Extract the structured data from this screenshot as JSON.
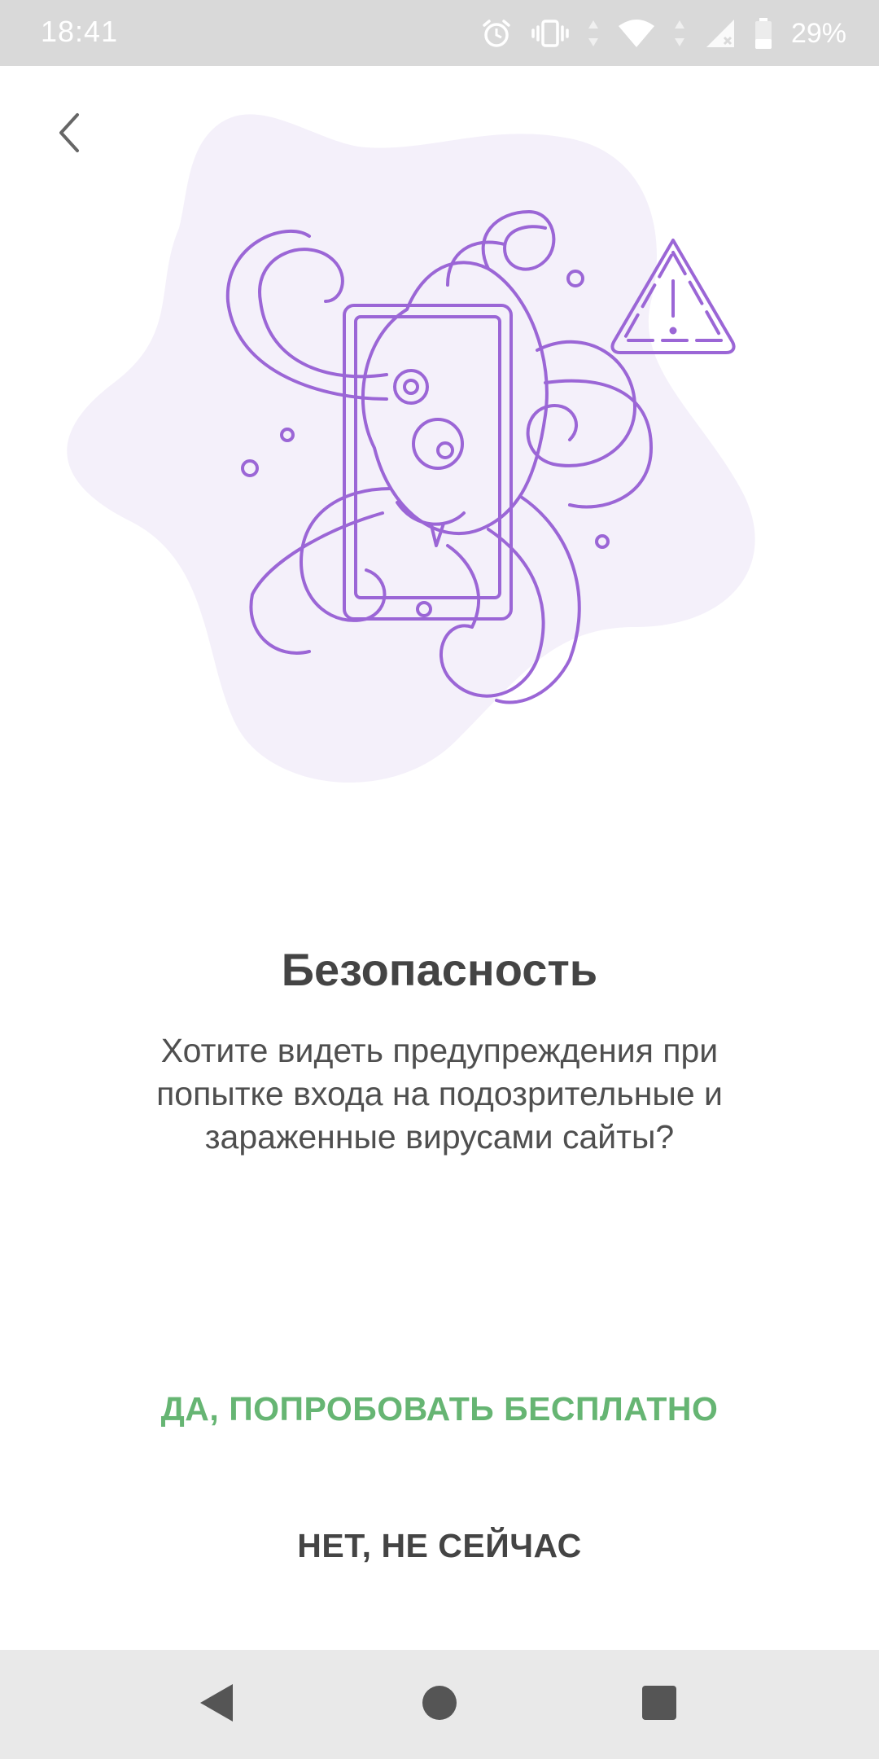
{
  "status_bar": {
    "time": "18:41",
    "battery_percent": "29%",
    "icons": [
      "alarm-icon",
      "vibrate-icon",
      "wifi-icon",
      "signal-icon",
      "battery-icon"
    ]
  },
  "header": {
    "back_icon": "chevron-left-icon"
  },
  "illustration": {
    "subject": "octopus-on-phone-icon",
    "warning_icon": "warning-triangle-icon",
    "accent_color": "#9b66d6",
    "blob_color": "#f4f0fa"
  },
  "content": {
    "title": "Безопасность",
    "description": "Хотите видеть предупреждения при попытке входа на подозрительные и зараженные вирусами сайты?"
  },
  "actions": {
    "primary_label": "ДА, ПОПРОБОВАТЬ БЕСПЛАТНО",
    "primary_color": "#66b573",
    "secondary_label": "НЕТ, НЕ СЕЙЧАС"
  },
  "nav_bar": {
    "back_icon": "nav-back-icon",
    "home_icon": "nav-home-icon",
    "recents_icon": "nav-recents-icon"
  }
}
